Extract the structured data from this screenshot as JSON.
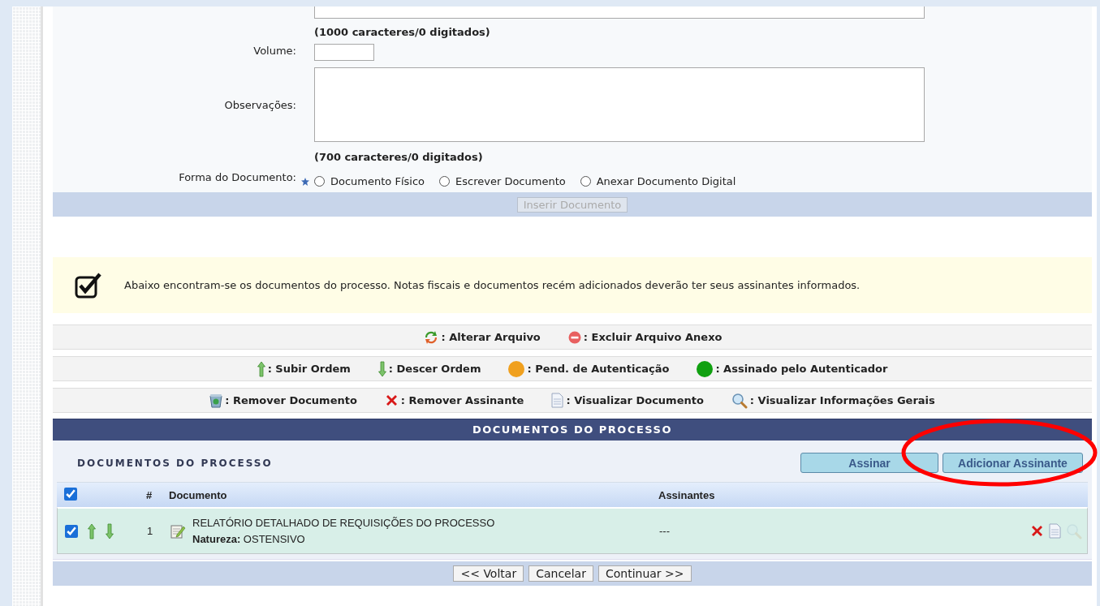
{
  "form": {
    "fields": [
      {
        "kind": "textarea_cut",
        "counter": "(1000 caracteres/0 digitados)"
      },
      {
        "kind": "input",
        "label": "Volume:"
      },
      {
        "kind": "textarea",
        "label": "Observações:",
        "counter": "(700 caracteres/0 digitados)"
      }
    ],
    "document_form": {
      "label": "Forma do Documento:",
      "required": true,
      "options": [
        {
          "label": "Documento Físico",
          "selected": false
        },
        {
          "label": "Escrever Documento",
          "selected": false
        },
        {
          "label": "Anexar Documento Digital",
          "selected": false
        }
      ]
    },
    "submit": {
      "label": "Inserir Documento",
      "disabled": true
    }
  },
  "notice": {
    "text": "Abaixo encontram-se os documentos do processo. Notas fiscais e documentos recém adicionados deverão ter seus assinantes informados."
  },
  "legend": [
    [
      {
        "kind": "change",
        "label": ": Alterar Arquivo"
      },
      {
        "kind": "delete_attachment",
        "label": ": Excluir Arquivo Anexo"
      }
    ],
    [
      {
        "kind": "up",
        "label": ": Subir Ordem"
      },
      {
        "kind": "down",
        "label": ": Descer Ordem"
      },
      {
        "kind": "dot",
        "color": "#f0a01e",
        "label": ": Pend. de Autenticação"
      },
      {
        "kind": "dot",
        "color": "#10a010",
        "label": ": Assinado pelo Autenticador"
      }
    ],
    [
      {
        "kind": "trash",
        "label": ": Remover Documento"
      },
      {
        "kind": "cross",
        "label": ": Remover Assinante"
      },
      {
        "kind": "document",
        "label": ": Visualizar Documento"
      },
      {
        "kind": "magnifier",
        "label": ": Visualizar Informações Gerais"
      }
    ]
  ],
  "table": {
    "title": "DOCUMENTOS DO PROCESSO",
    "subtitle": "DOCUMENTOS DO PROCESSO",
    "actions": [
      {
        "label": "Assinar"
      },
      {
        "label": "Adicionar Assinante",
        "highlighted": true
      }
    ],
    "all_checked": true,
    "columns": [
      "#",
      "Documento",
      "Assinantes"
    ],
    "rows": [
      {
        "checked": true,
        "number": "1",
        "title": "RELATÓRIO DETALHADO DE REQUISIÇÕES DO PROCESSO",
        "nature": "**Natureza:** OSTENSIVO",
        "signers": "---",
        "actions": [
          {
            "kind": "cross",
            "disabled": false
          },
          {
            "kind": "document",
            "disabled": false
          },
          {
            "kind": "magnifier",
            "disabled": true
          }
        ]
      }
    ]
  },
  "buttons": [
    "<< Voltar",
    "Cancelar",
    "Continuar >>"
  ]
}
